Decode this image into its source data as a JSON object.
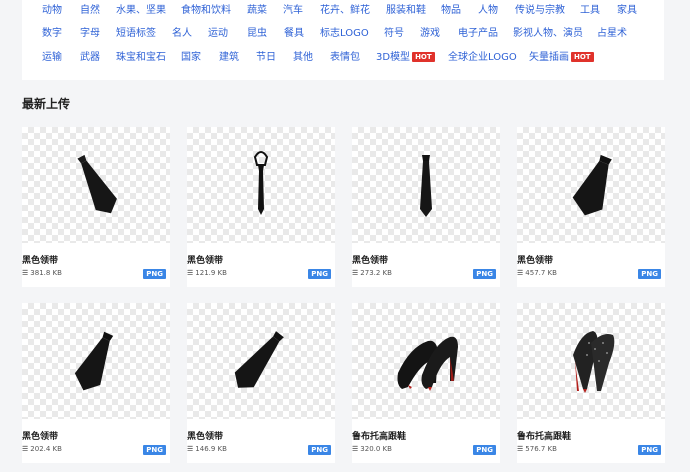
{
  "categories": {
    "row1": [
      "动物",
      "自然",
      "水果、坚果",
      "食物和饮料",
      "蔬菜",
      "汽车",
      "花卉、鲜花",
      "服装和鞋",
      "物品",
      "人物",
      "传说与宗教",
      "工具",
      "家具"
    ],
    "row2": [
      "数字",
      "字母",
      "短语标签",
      "名人",
      "运动",
      "昆虫",
      "餐具",
      "标志LOGO",
      "符号",
      "游戏",
      "电子产品",
      "影视人物、演员",
      "占星术"
    ],
    "row3": [
      "运输",
      "武器",
      "珠宝和宝石",
      "国家",
      "建筑",
      "节日",
      "其他",
      "表情包",
      "3D模型",
      "全球企业LOGO",
      "矢量插画"
    ],
    "hot_label": "HOT"
  },
  "section_title": "最新上传",
  "items": [
    {
      "title": "黑色领带",
      "size": "381.8 KB",
      "format": "PNG",
      "icon": "necktie-image"
    },
    {
      "title": "黑色领带",
      "size": "121.9 KB",
      "format": "PNG",
      "icon": "necktie-image"
    },
    {
      "title": "黑色领带",
      "size": "273.2 KB",
      "format": "PNG",
      "icon": "necktie-image"
    },
    {
      "title": "黑色领带",
      "size": "457.7 KB",
      "format": "PNG",
      "icon": "necktie-image"
    },
    {
      "title": "黑色领带",
      "size": "202.4 KB",
      "format": "PNG",
      "icon": "necktie-image"
    },
    {
      "title": "黑色领带",
      "size": "146.9 KB",
      "format": "PNG",
      "icon": "necktie-image"
    },
    {
      "title": "鲁布托高跟鞋",
      "size": "320.0 KB",
      "format": "PNG",
      "icon": "high-heels-image"
    },
    {
      "title": "鲁布托高跟鞋",
      "size": "576.7 KB",
      "format": "PNG",
      "icon": "high-heels-image"
    }
  ],
  "colors": {
    "link": "#2f62d6",
    "hot": "#e0322b",
    "badge": "#3a86e6"
  }
}
